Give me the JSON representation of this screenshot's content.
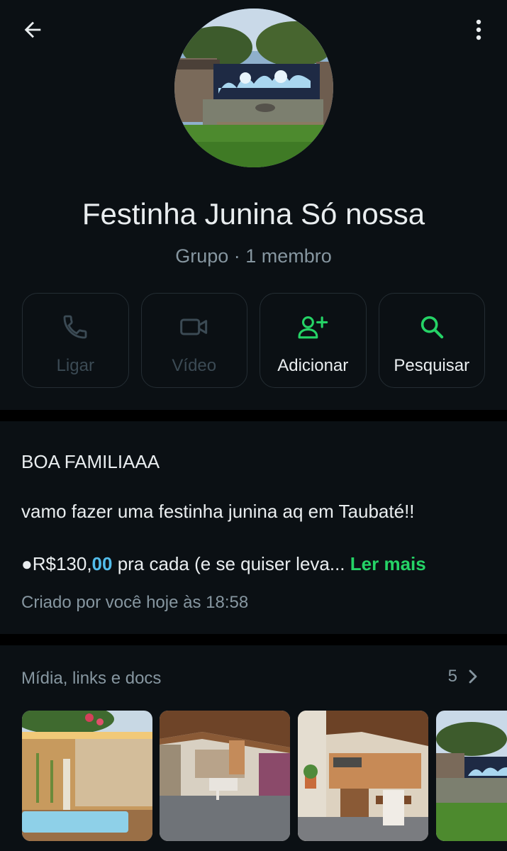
{
  "header": {
    "back_icon": "arrow-left-icon",
    "more_icon": "more-vertical-icon"
  },
  "group": {
    "name": "Festinha Junina Só nossa",
    "meta": "Grupo · 1 membro"
  },
  "actions": [
    {
      "label": "Ligar",
      "icon": "phone-icon",
      "enabled": false
    },
    {
      "label": "Vídeo",
      "icon": "video-icon",
      "enabled": false
    },
    {
      "label": "Adicionar",
      "icon": "add-person-icon",
      "enabled": true
    },
    {
      "label": "Pesquisar",
      "icon": "search-icon",
      "enabled": true
    }
  ],
  "description": {
    "line1": "BOA FAMILIAAA",
    "line2": "vamo fazer uma festinha junina aq em Taubaté!!",
    "line3_prefix": "●R$130,",
    "line3_highlight": "00",
    "line3_suffix": " pra cada (e se quiser leva...",
    "read_more": "Ler mais",
    "created": "Criado por você hoje às 18:58"
  },
  "media": {
    "title": "Mídia, links e docs",
    "count": "5"
  },
  "colors": {
    "accent_green": "#25d366",
    "background": "#0b1014",
    "muted": "#8696a0",
    "link_blue": "#53bdeb"
  }
}
